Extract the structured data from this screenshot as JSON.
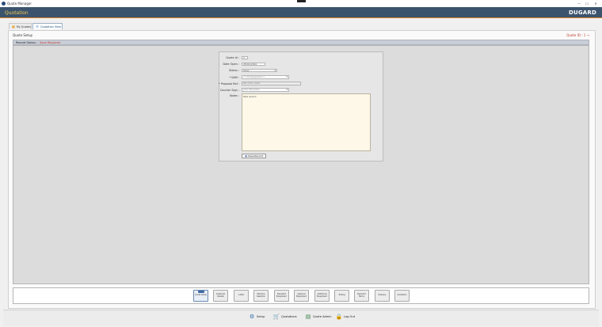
{
  "window": {
    "title": "Quote Manager",
    "controls": {
      "minimize": "—",
      "maximize": "☐",
      "close": "✕"
    }
  },
  "header": {
    "title": "Quotation",
    "brand": "DUGARD",
    "colors": {
      "bar": "#3c536e",
      "title": "#f2c94c",
      "accent": "#d9822b"
    }
  },
  "tabs": [
    {
      "label": "My Quotes",
      "icon": "folder-icon",
      "active": false
    },
    {
      "label": "Quotation View",
      "icon": "network-icon",
      "active": true
    }
  ],
  "section": {
    "label": "Quote Setup",
    "quote_id_label": "Quote ID : 1"
  },
  "record_status": {
    "label": "Record Status :",
    "value": "Save Required"
  },
  "form": {
    "quote_id": {
      "label": "Quote Id :",
      "value": "1"
    },
    "date_open": {
      "label": "Date Open :",
      "value": "28/01/2022"
    },
    "status": {
      "label": "Status :",
      "value": "Open"
    },
    "kam": {
      "label": "* KAM :",
      "value": "<<Unassigned>>"
    },
    "proposal_ref": {
      "label": "* Proposal Ref :",
      "value": "RE-2201-0001"
    },
    "counter_sign": {
      "label": "Counter Sign :",
      "value": "John Thornton"
    },
    "notes": {
      "label": "Notes :",
      "value": "Test record"
    },
    "save_button": "Save Record"
  },
  "steps": [
    "Quote Setup",
    "Customer Details",
    "Lathe",
    "Machine Selection",
    "Standard Equipment",
    "Optional Equipment",
    "Additional Equipment",
    "Tooling",
    "Payment Terms",
    "Delivery",
    "Quotation"
  ],
  "toolbar": [
    {
      "label": "Setup",
      "icon": "gear-icon"
    },
    {
      "label": "Quotations",
      "icon": "cart-icon"
    },
    {
      "label": "Quote Admin",
      "icon": "document-icon"
    },
    {
      "label": "Log Out",
      "icon": "lock-icon"
    }
  ]
}
